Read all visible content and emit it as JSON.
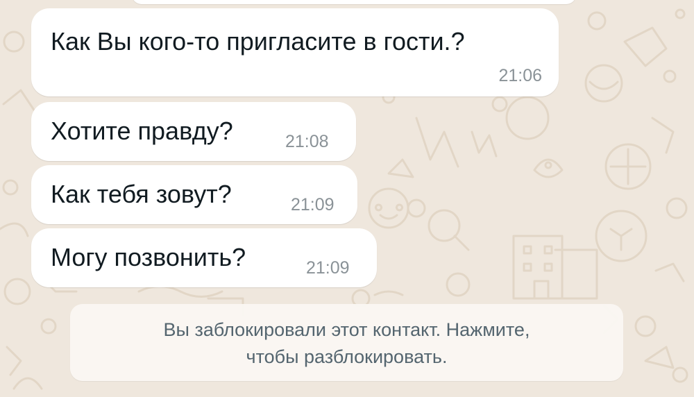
{
  "chat": {
    "messages": [
      {
        "text": "Как Вы кого-то пригласите в гости.?",
        "time": "21:06"
      },
      {
        "text": "Хотите правду?",
        "time": "21:08"
      },
      {
        "text": "Как тебя зовут?",
        "time": "21:09"
      },
      {
        "text": "Могу позвонить?",
        "time": "21:09"
      }
    ],
    "blocked_notice": {
      "line1": "Вы заблокировали этот контакт. Нажмите,",
      "line2": "чтобы разблокировать."
    }
  },
  "colors": {
    "wallpaper": "#efe7dd",
    "doodle": "#e2d6c6",
    "bubble": "#ffffff",
    "text": "#111b21",
    "timestamp": "#8a9297",
    "notice_text": "#54656f"
  }
}
